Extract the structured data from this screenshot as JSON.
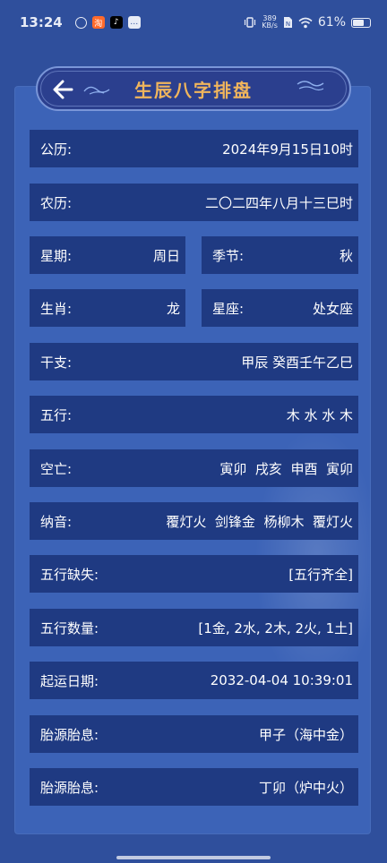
{
  "status_bar": {
    "time": "13:24",
    "net_speed_value": "389",
    "net_speed_unit": "KB/s",
    "battery": "61%",
    "battery_level": 0.61
  },
  "header": {
    "title": "生辰八字排盘"
  },
  "rows": {
    "gongli": {
      "label": "公历:",
      "value": "2024年9月15日10时"
    },
    "nongli": {
      "label": "农历:",
      "value": "二〇二四年八月十三巳时"
    },
    "xingqi": {
      "label": "星期:",
      "value": "周日"
    },
    "jijie": {
      "label": "季节:",
      "value": "秋"
    },
    "shengxiao": {
      "label": "生肖:",
      "value": "龙"
    },
    "xingzuo": {
      "label": "星座:",
      "value": "处女座"
    },
    "ganzhi": {
      "label": "干支:",
      "value": "甲辰 癸酉壬午乙巳"
    },
    "wuxing": {
      "label": "五行:",
      "value": "木 水 水 木"
    },
    "kongwang": {
      "label": "空亡:",
      "value": "寅卯  戌亥  申酉  寅卯"
    },
    "nayin": {
      "label": "纳音:",
      "value": "覆灯火  剑锋金  杨柳木  覆灯火"
    },
    "wuxing_queshi": {
      "label": "五行缺失:",
      "value": "[五行齐全]"
    },
    "wuxing_shuliang": {
      "label": "五行数量:",
      "value": "[1金, 2水, 2木, 2火, 1土]"
    },
    "qiyun_riqi": {
      "label": "起运日期:",
      "value": "2032-04-04 10:39:01"
    },
    "taiyuan": {
      "label": "胎源胎息:",
      "value": "甲子（海中金）"
    },
    "taixi": {
      "label": "胎源胎息:",
      "value": "丁卯（炉中火）"
    }
  },
  "colors": {
    "background": "#2f4f9c",
    "panel": "#3c63b7",
    "row": "#1f3a82",
    "title": "#f0b55c"
  }
}
